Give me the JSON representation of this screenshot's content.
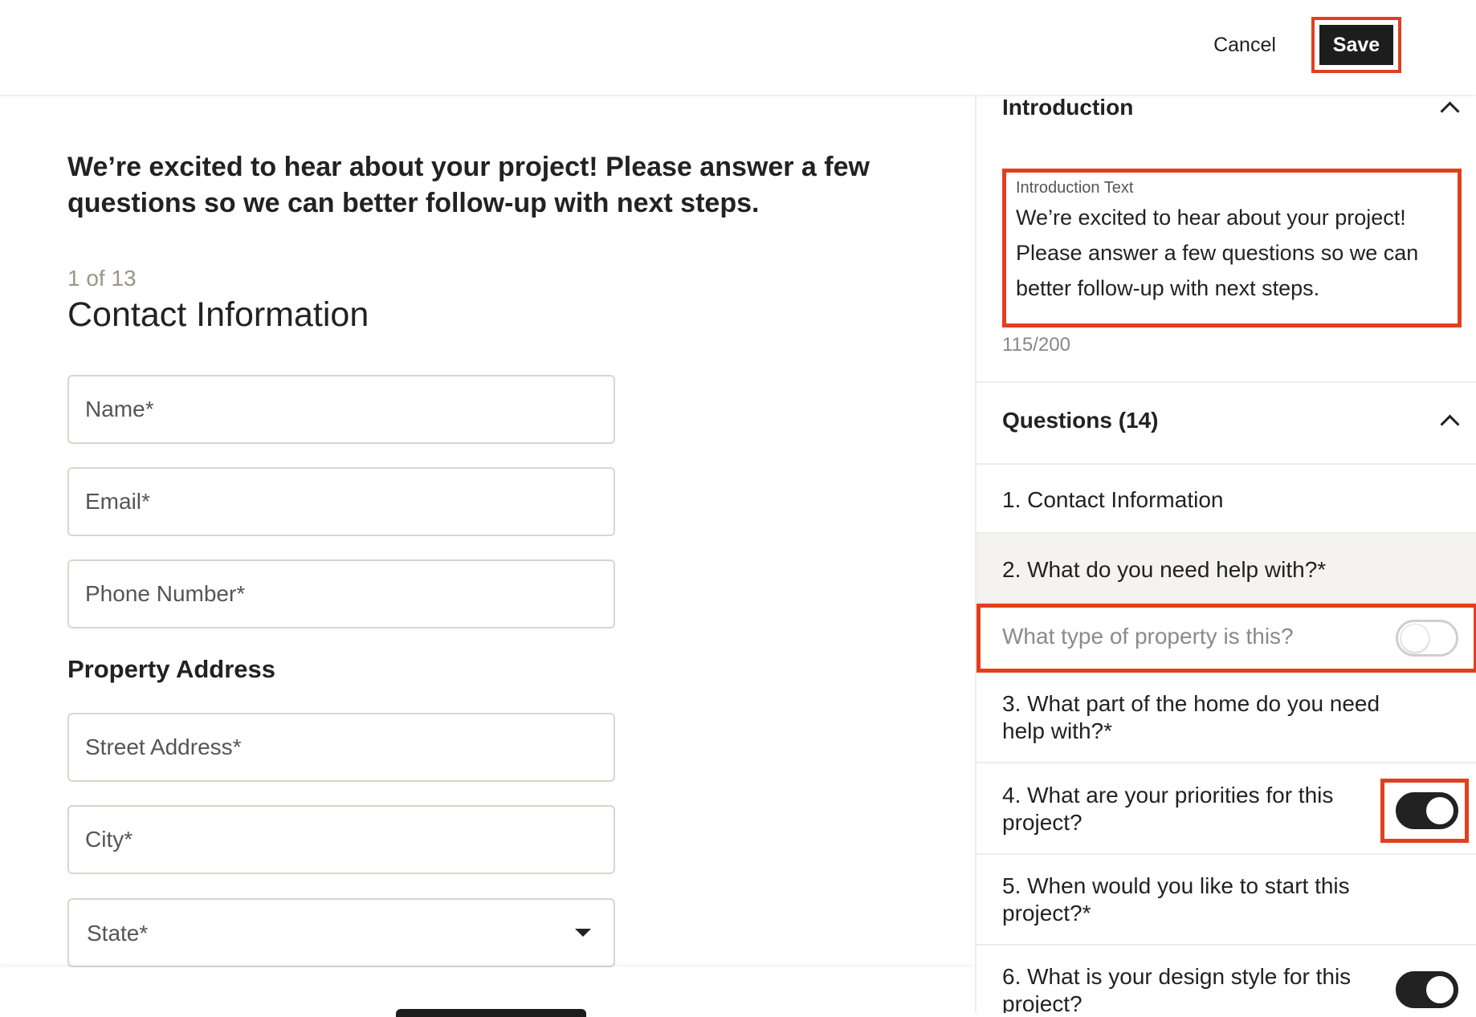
{
  "header": {
    "cancel_label": "Cancel",
    "save_label": "Save"
  },
  "preview": {
    "intro_text": "We’re excited to hear about your project! Please answer a few questions so we can better follow-up with next steps.",
    "step_indicator": "1 of 13",
    "section_title": "Contact Information",
    "fields": {
      "name_placeholder": "Name*",
      "email_placeholder": "Email*",
      "phone_placeholder": "Phone Number*"
    },
    "address_title": "Property Address",
    "address_fields": {
      "street_placeholder": "Street Address*",
      "city_placeholder": "City*",
      "state_label": "State*"
    }
  },
  "sidebar": {
    "introduction": {
      "title": "Introduction",
      "field_label": "Introduction Text",
      "field_value": "We’re excited to hear about your project! Please answer a few questions so we can better follow-up with next steps.",
      "counter": "115/200"
    },
    "questions": {
      "title": "Questions (14)",
      "items": [
        {
          "label": "1. Contact Information"
        },
        {
          "label": "2. What do you need help with?*"
        },
        {
          "label": "What type of property is this?",
          "toggle": "off"
        },
        {
          "label": "3. What part of the home do you need help with?*"
        },
        {
          "label": "4. What are your priorities for this project?",
          "toggle": "on"
        },
        {
          "label": "5. When would you like to start this project?*"
        },
        {
          "label": "6. What is your design style for this project?",
          "toggle": "on"
        }
      ]
    }
  },
  "colors": {
    "highlight": "#e0401f",
    "primary_button": "#1d1d1d",
    "step_indicator": "#9b9684"
  }
}
